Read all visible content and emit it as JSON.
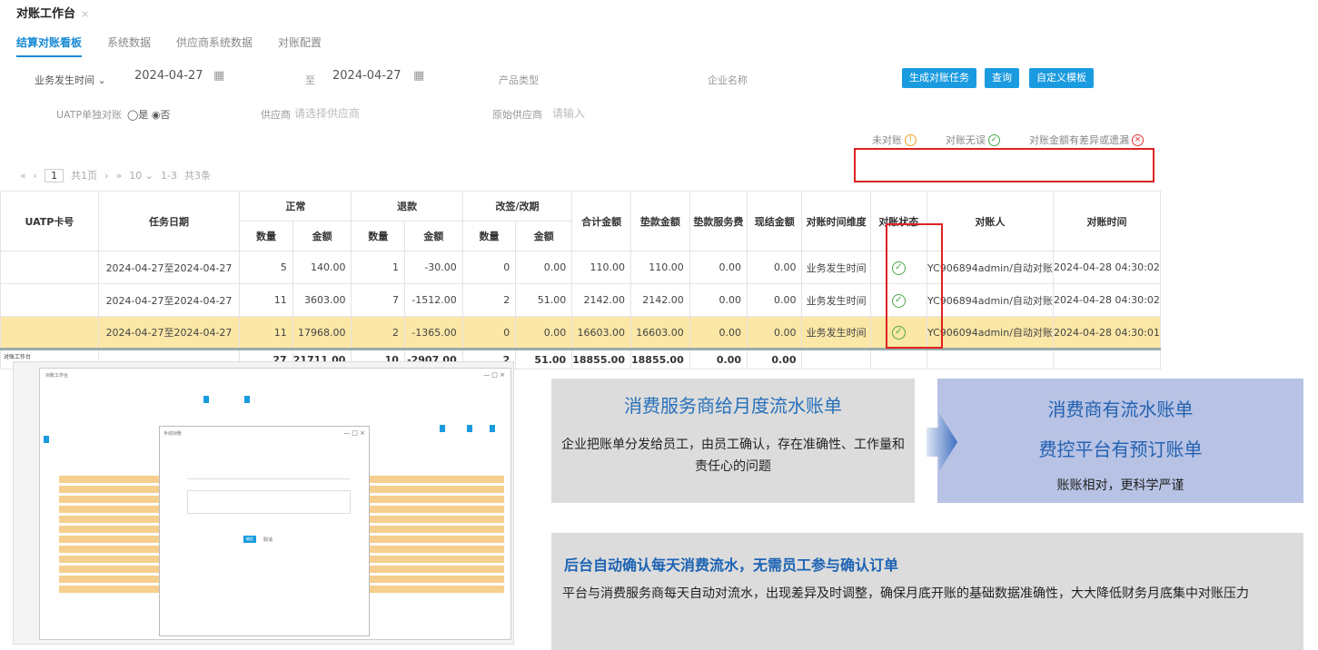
{
  "page_tab": {
    "label": "对账工作台"
  },
  "tabs": [
    "结算对账看板",
    "系统数据",
    "供应商系统数据",
    "对账配置"
  ],
  "filters": {
    "date_type": "业务发生时间",
    "date_from": "2024-04-27",
    "to_label": "至",
    "date_to": "2024-04-27",
    "product_type_label": "产品类型",
    "company_label": "企业名称",
    "uatp_label": "UATP单独对账",
    "uatp_options": "◯是 ◉否",
    "supplier_label": "供应商",
    "supplier_placeholder": "请选择供应商",
    "system_supplier_label": "原始供应商",
    "system_supplier_placeholder": "请输入"
  },
  "buttons": {
    "generate": "生成对账任务",
    "query": "查询",
    "custom": "自定义模板"
  },
  "status_legend": {
    "pending": "未对账",
    "ok": "对账无误",
    "diff": "对账金额有差异或遗漏"
  },
  "pager": {
    "current": "1",
    "total_pages": "共1页",
    "page_size": "10",
    "range": "1-3",
    "total": "共3条"
  },
  "table": {
    "headers": {
      "uatp": "UATP卡号",
      "task_date": "任务日期",
      "normal": "正常",
      "refund": "退款",
      "change": "改签/改期",
      "count": "数量",
      "amount": "金额",
      "total": "合计金额",
      "advance": "垫款金额",
      "advance_fee": "垫款服务费",
      "settled": "现结金额",
      "time_dim": "对账时间维度",
      "status": "对账状态",
      "person": "对账人",
      "time": "对账时间"
    },
    "rows": [
      {
        "uatp": "",
        "task_date": "2024-04-27至2024-04-27",
        "n_cnt": "5",
        "n_amt": "140.00",
        "r_cnt": "1",
        "r_amt": "-30.00",
        "c_cnt": "0",
        "c_amt": "0.00",
        "total": "110.00",
        "advance": "110.00",
        "advance_fee": "0.00",
        "settled": "0.00",
        "time_dim": "业务发生时间",
        "person": "YC906894admin/自动对账",
        "time": "2024-04-28 04:30:02"
      },
      {
        "uatp": "",
        "task_date": "2024-04-27至2024-04-27",
        "n_cnt": "11",
        "n_amt": "3603.00",
        "r_cnt": "7",
        "r_amt": "-1512.00",
        "c_cnt": "2",
        "c_amt": "51.00",
        "total": "2142.00",
        "advance": "2142.00",
        "advance_fee": "0.00",
        "settled": "0.00",
        "time_dim": "业务发生时间",
        "person": "YC906894admin/自动对账",
        "time": "2024-04-28 04:30:02"
      },
      {
        "uatp": "",
        "task_date": "2024-04-27至2024-04-27",
        "n_cnt": "11",
        "n_amt": "17968.00",
        "r_cnt": "2",
        "r_amt": "-1365.00",
        "c_cnt": "0",
        "c_amt": "0.00",
        "total": "16603.00",
        "advance": "16603.00",
        "advance_fee": "0.00",
        "settled": "0.00",
        "time_dim": "业务发生时间",
        "person": "YC906094admin/自动对账",
        "time": "2024-04-28 04:30:01"
      }
    ],
    "footer": {
      "n_cnt": "27",
      "n_amt": "21711.00",
      "r_cnt": "10",
      "r_amt": "-2907.00",
      "c_cnt": "2",
      "c_amt": "51.00",
      "total": "18855.00",
      "advance": "18855.00",
      "advance_fee": "0.00",
      "settled": "0.00"
    }
  },
  "mini_screenshot": {
    "title": "对账工作台",
    "window_title": "对账工作台",
    "dialog_title": "手动对账",
    "dialog_confirm": "确定",
    "dialog_cancel": "取消"
  },
  "card_left": {
    "title": "消费服务商给月度流水账单",
    "body": "企业把账单分发给员工，由员工确认，存在准确性、工作量和责任心的问题"
  },
  "card_right": {
    "title1": "消费商有流水账单",
    "title2": "费控平台有预订账单",
    "body": "账账相对，更科学严谨"
  },
  "card_bottom": {
    "title": "后台自动确认每天消费流水，无需员工参与确认订单",
    "body": "平台与消费服务商每天自动对流水，出现差异及时调整，确保月底开账的基础数据准确性，大大降低财务月底集中对账压力"
  },
  "colors": {
    "primary": "#1a9be0",
    "highlight_row": "#fbe7a6",
    "red_box": "#dd2222",
    "card_gray": "#dcdcdc",
    "card_blue": "#b7c2e4",
    "title_blue": "#2770ba"
  }
}
